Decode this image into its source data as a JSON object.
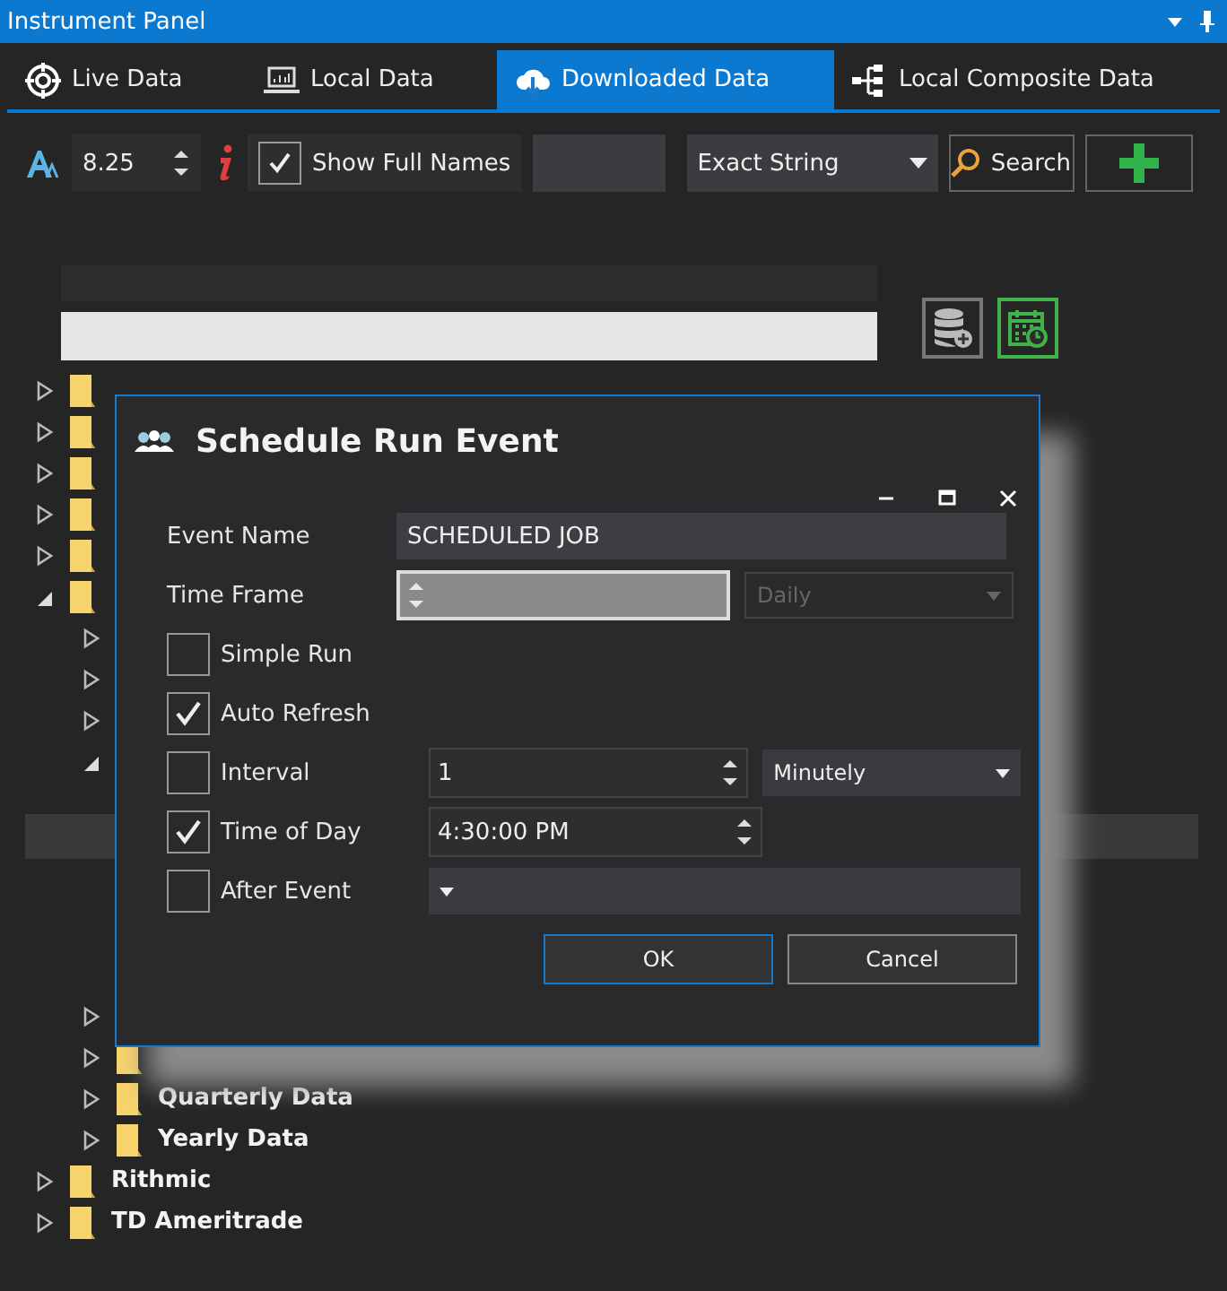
{
  "window": {
    "title": "Instrument Panel"
  },
  "tabs": [
    {
      "label": "Live Data",
      "selected": false
    },
    {
      "label": "Local Data",
      "selected": false
    },
    {
      "label": "Downloaded Data",
      "selected": true
    },
    {
      "label": "Local Composite Data",
      "selected": false
    }
  ],
  "toolbar": {
    "font_size": "8.25",
    "show_full_names": {
      "label": "Show Full Names",
      "checked": true
    },
    "search_mode": "Exact String",
    "search_button": "Search"
  },
  "tree": [
    {
      "expanded": false
    },
    {
      "expanded": false
    },
    {
      "expanded": false
    },
    {
      "expanded": false
    },
    {
      "expanded": false
    },
    {
      "expanded": true,
      "children": [
        {
          "expanded": false
        },
        {
          "expanded": false
        },
        {
          "expanded": false
        },
        {
          "expanded": true
        },
        {
          "expanded": false
        },
        {
          "expanded": false
        },
        {
          "label": "Quarterly Data",
          "expanded": false
        },
        {
          "label": "Yearly Data",
          "expanded": false
        }
      ]
    },
    {
      "label": "Rithmic",
      "expanded": false
    },
    {
      "label": "TD Ameritrade",
      "expanded": false
    }
  ],
  "dialog": {
    "title": "Schedule Run Event",
    "fields": [
      {
        "kind": "text",
        "label": "Event Name",
        "value": "SCHEDULED JOB"
      },
      {
        "kind": "spincombo",
        "label": "Time Frame",
        "disabled": true,
        "option": "Daily"
      },
      {
        "kind": "check",
        "label": "Simple Run",
        "checked": false
      },
      {
        "kind": "check",
        "label": "Auto Refresh",
        "checked": true
      },
      {
        "kind": "checkspincombo",
        "label": "Interval",
        "checked": false,
        "value": "1",
        "option": "Minutely"
      },
      {
        "kind": "checkspin",
        "label": "Time of Day",
        "checked": true,
        "value": "4:30:00 PM"
      },
      {
        "kind": "checkcombo",
        "label": "After Event",
        "checked": false
      }
    ],
    "buttons": [
      {
        "label": "OK",
        "default": true
      },
      {
        "label": "Cancel",
        "default": false
      }
    ]
  }
}
